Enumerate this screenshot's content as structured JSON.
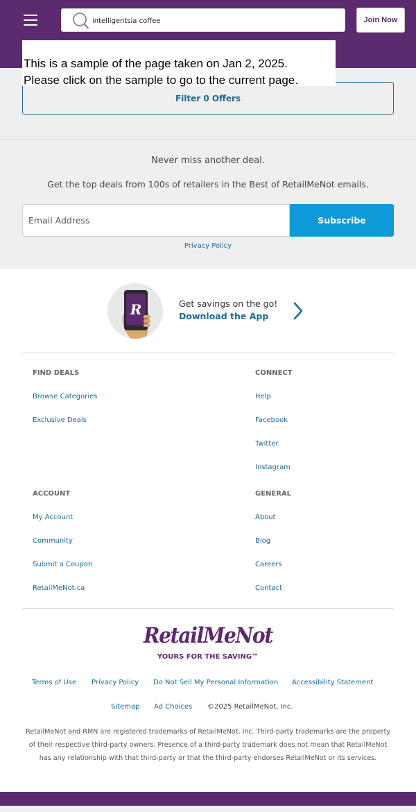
{
  "colors": {
    "brand": "#5c2a6e",
    "link": "#1e6a93",
    "accent": "#0e9ad9",
    "gray_bg": "#efefef"
  },
  "header": {
    "menu_icon": "hamburger-icon",
    "search_icon": "search-icon",
    "search_value": "intelligentsia coffee",
    "join_label": "Join Now"
  },
  "sample_notice": {
    "line1": "This is a sample of the page taken on Jan 2, 2025.",
    "line2": "Please click on the sample to go to the current page."
  },
  "filter": {
    "label": "Filter 0 Offers"
  },
  "newsletter": {
    "title": "Never miss another deal.",
    "subtitle": "Get the top deals from 100s of retailers in the Best of RetailMeNot emails.",
    "email_placeholder": "Email Address",
    "subscribe_label": "Subscribe",
    "privacy_label": "Privacy Policy"
  },
  "app_promo": {
    "icon": "phone-app-icon",
    "tagline": "Get savings on the go!",
    "link_label": "Download the App",
    "chevron_icon": "chevron-right-icon"
  },
  "footer": {
    "find_deals": {
      "heading": "FIND DEALS",
      "links": [
        "Browse Categories",
        "Exclusive Deals"
      ]
    },
    "connect": {
      "heading": "CONNECT",
      "links": [
        "Help",
        "Facebook",
        "Twitter",
        "Instagram"
      ]
    },
    "account": {
      "heading": "ACCOUNT",
      "links": [
        "My Account",
        "Community",
        "Submit a Coupon",
        "RetailMeNot.ca"
      ]
    },
    "general": {
      "heading": "GENERAL",
      "links": [
        "About",
        "Blog",
        "Careers",
        "Contact"
      ]
    }
  },
  "brand": {
    "logo_text": "RetailMeNot",
    "tagline": "YOURS FOR THE SAVING™"
  },
  "bottom_links": {
    "row1": [
      "Terms of Use",
      "Privacy Policy",
      "Do Not Sell My Personal Information",
      "Accessibility Statement"
    ],
    "row2": [
      "Sitemap",
      "Ad Choices"
    ],
    "copyright": "©2025 RetailMeNot, Inc."
  },
  "legal": "RetailMeNot and RMN are registered trademarks of RetailMeNot, Inc. Third-party trademarks are the property of their respective third-party owners. Presence of a third-party trademark does not mean that RetailMeNot has any relationship with that third-party or that the third-party endorses RetailMeNot or its services."
}
